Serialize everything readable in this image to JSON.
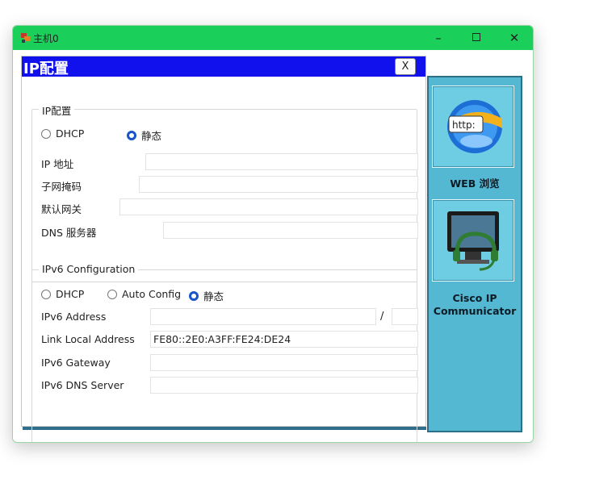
{
  "window": {
    "title": "主机0",
    "minimize": "–",
    "close": "✕"
  },
  "dialog": {
    "title": "IP配置",
    "close_label": "X"
  },
  "ipv4": {
    "group_title": "IP配置",
    "dhcp_label": "DHCP",
    "static_label": "静态",
    "mode_selected": "静态",
    "ip_label": "IP 地址",
    "ip_value": "",
    "mask_label": "子网掩码",
    "mask_value": "",
    "gateway_label": "默认网关",
    "gateway_value": "",
    "dns_label": "DNS 服务器",
    "dns_value": ""
  },
  "ipv6": {
    "group_title": "IPv6 Configuration",
    "dhcp_label": "DHCP",
    "auto_label": "Auto Config",
    "static_label": "静态",
    "mode_selected": "静态",
    "address_label": "IPv6 Address",
    "address_value": "",
    "prefix_separator": "/",
    "prefix_value": "",
    "link_local_label": "Link Local Address",
    "link_local_value": "FE80::2E0:A3FF:FE24:DE24",
    "gateway_label": "IPv6 Gateway",
    "gateway_value": "",
    "dns_label": "IPv6 DNS Server",
    "dns_value": ""
  },
  "side_apps": [
    {
      "label": "WEB 浏览",
      "icon": "browser-icon"
    },
    {
      "label": "Cisco IP Communicator",
      "icon": "ip-communicator-icon"
    }
  ],
  "colors": {
    "titlebar": "#1bd05a",
    "dialog_header": "#1111ee",
    "side_panel": "#55b8d3",
    "radio_selected": "#1a55c8"
  }
}
